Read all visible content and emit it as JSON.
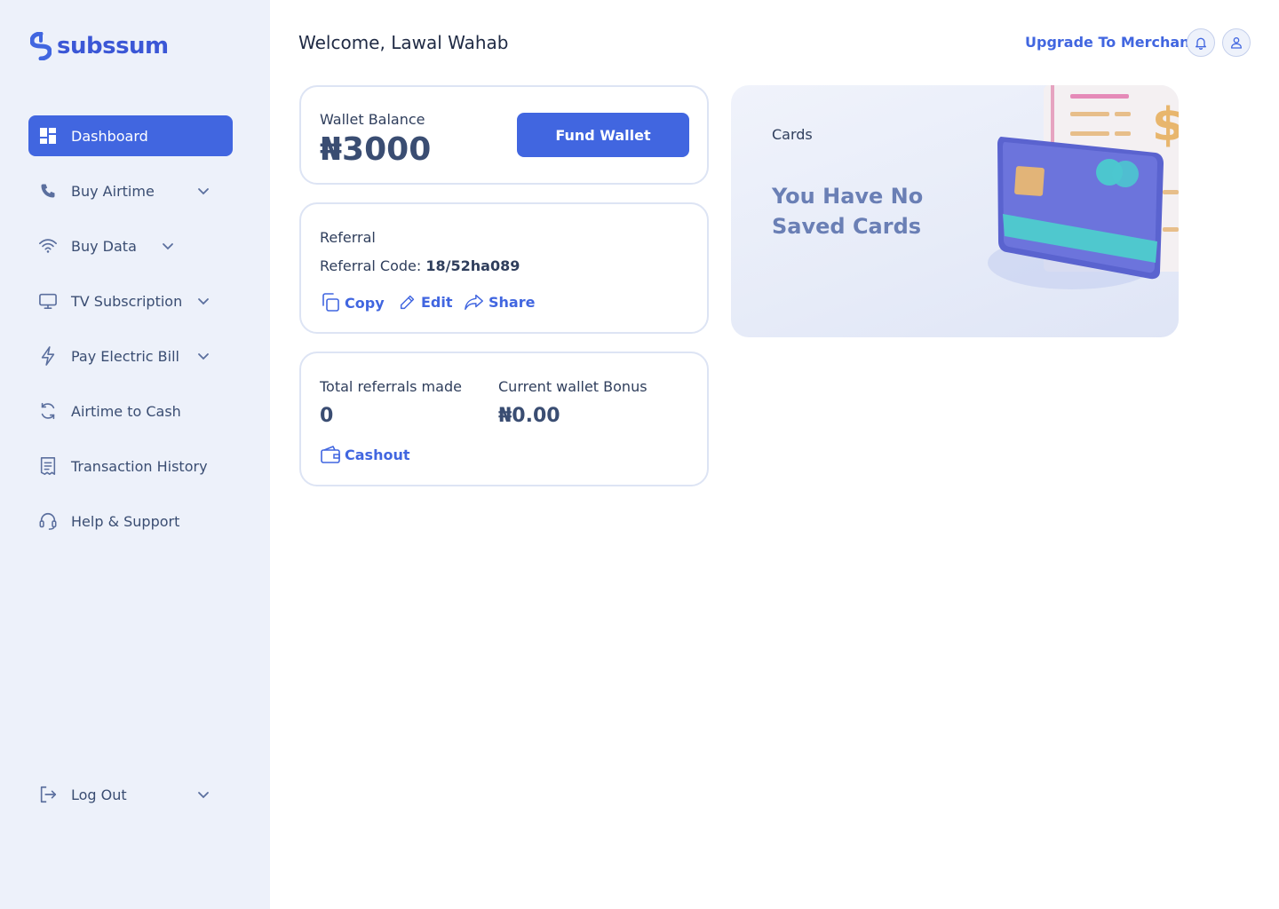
{
  "brand": {
    "name": "subssum",
    "color": "#4166e0"
  },
  "sidebar": {
    "items": [
      {
        "label": "Dashboard",
        "icon": "grid-icon",
        "active": true
      },
      {
        "label": "Buy Airtime",
        "icon": "phone-icon",
        "dropdown": true
      },
      {
        "label": "Buy Data",
        "icon": "wifi-icon",
        "dropdown": true
      },
      {
        "label": "TV Subscription",
        "icon": "tv-icon",
        "dropdown": true
      },
      {
        "label": "Pay Electric Bill",
        "icon": "bolt-icon",
        "dropdown": true
      },
      {
        "label": "Airtime to Cash",
        "icon": "refresh-icon"
      },
      {
        "label": "Transaction History",
        "icon": "receipt-icon"
      },
      {
        "label": "Help & Support",
        "icon": "headset-icon"
      }
    ],
    "logout": {
      "label": "Log Out",
      "icon": "logout-icon"
    }
  },
  "header": {
    "welcome": "Welcome, Lawal Wahab",
    "upgrade_label": "Upgrade To Merchant"
  },
  "wallet": {
    "label": "Wallet Balance",
    "balance": "₦3000",
    "fund_label": "Fund Wallet"
  },
  "referral": {
    "title": "Referral",
    "code_label": "Referral Code:",
    "code": "18/52ha089",
    "copy_label": "Copy",
    "edit_label": "Edit",
    "share_label": "Share"
  },
  "stats": {
    "referrals_label": "Total referrals made",
    "referrals_value": "0",
    "bonus_label": "Current wallet Bonus",
    "bonus_value": "₦0.00",
    "cashout_label": "Cashout"
  },
  "cards": {
    "title": "Cards",
    "empty_message": "You Have No Saved Cards"
  }
}
